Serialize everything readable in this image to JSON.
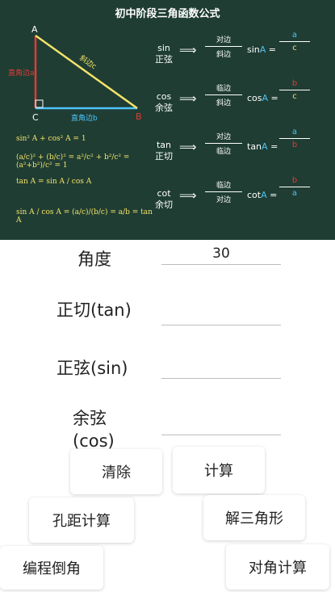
{
  "board": {
    "title": "初中阶段三角函数公式",
    "vertex_a": "A",
    "vertex_b": "B",
    "vertex_c": "C",
    "side_a_label": "直角边a",
    "side_b_label": "直角边b",
    "side_c_label": "斜边c",
    "formula_1": "sin² A + cos² A = 1",
    "formula_2": "(a/c)² + (b/c)² = a²/c² + b²/c² = (a²+b²)/c² = 1",
    "formula_3": "tan A = sin A / cos A",
    "formula_4": "sin A / cos A = (a/c)/(b/c) = a/b = tan A",
    "rows": [
      {
        "fn": "sin",
        "cn": "正弦",
        "num": "对边",
        "den": "斜边",
        "eq": "sin",
        "rnum": "a",
        "rden": "c"
      },
      {
        "fn": "cos",
        "cn": "余弦",
        "num": "临边",
        "den": "斜边",
        "eq": "cos",
        "rnum": "b",
        "rden": "c"
      },
      {
        "fn": "tan",
        "cn": "正切",
        "num": "对边",
        "den": "临边",
        "eq": "tan",
        "rnum": "a",
        "rden": "b"
      },
      {
        "fn": "cot",
        "cn": "余切",
        "num": "临边",
        "den": "对边",
        "eq": "cot",
        "rnum": "b",
        "rden": "a"
      }
    ],
    "eq_a": "A",
    "eq_sign": "=",
    "arrow": "⟹"
  },
  "form": {
    "angle_label": "角度",
    "angle_value": "30",
    "tan_label": "正切(tan)",
    "tan_value": "",
    "sin_label": "正弦(sin)",
    "sin_value": "",
    "cos_label_line1": "余弦",
    "cos_label_line2": "(cos)",
    "cos_value": ""
  },
  "buttons": {
    "clear": "清除",
    "calc": "计算",
    "hole": "孔距计算",
    "triangle": "解三角形",
    "chamfer": "编程倒角",
    "diagonal": "对角计算"
  },
  "colors": {
    "board_bg": "#1f3d33",
    "side_a": "#e53935",
    "side_b": "#4fc3f7",
    "side_c": "#f3e36a"
  }
}
